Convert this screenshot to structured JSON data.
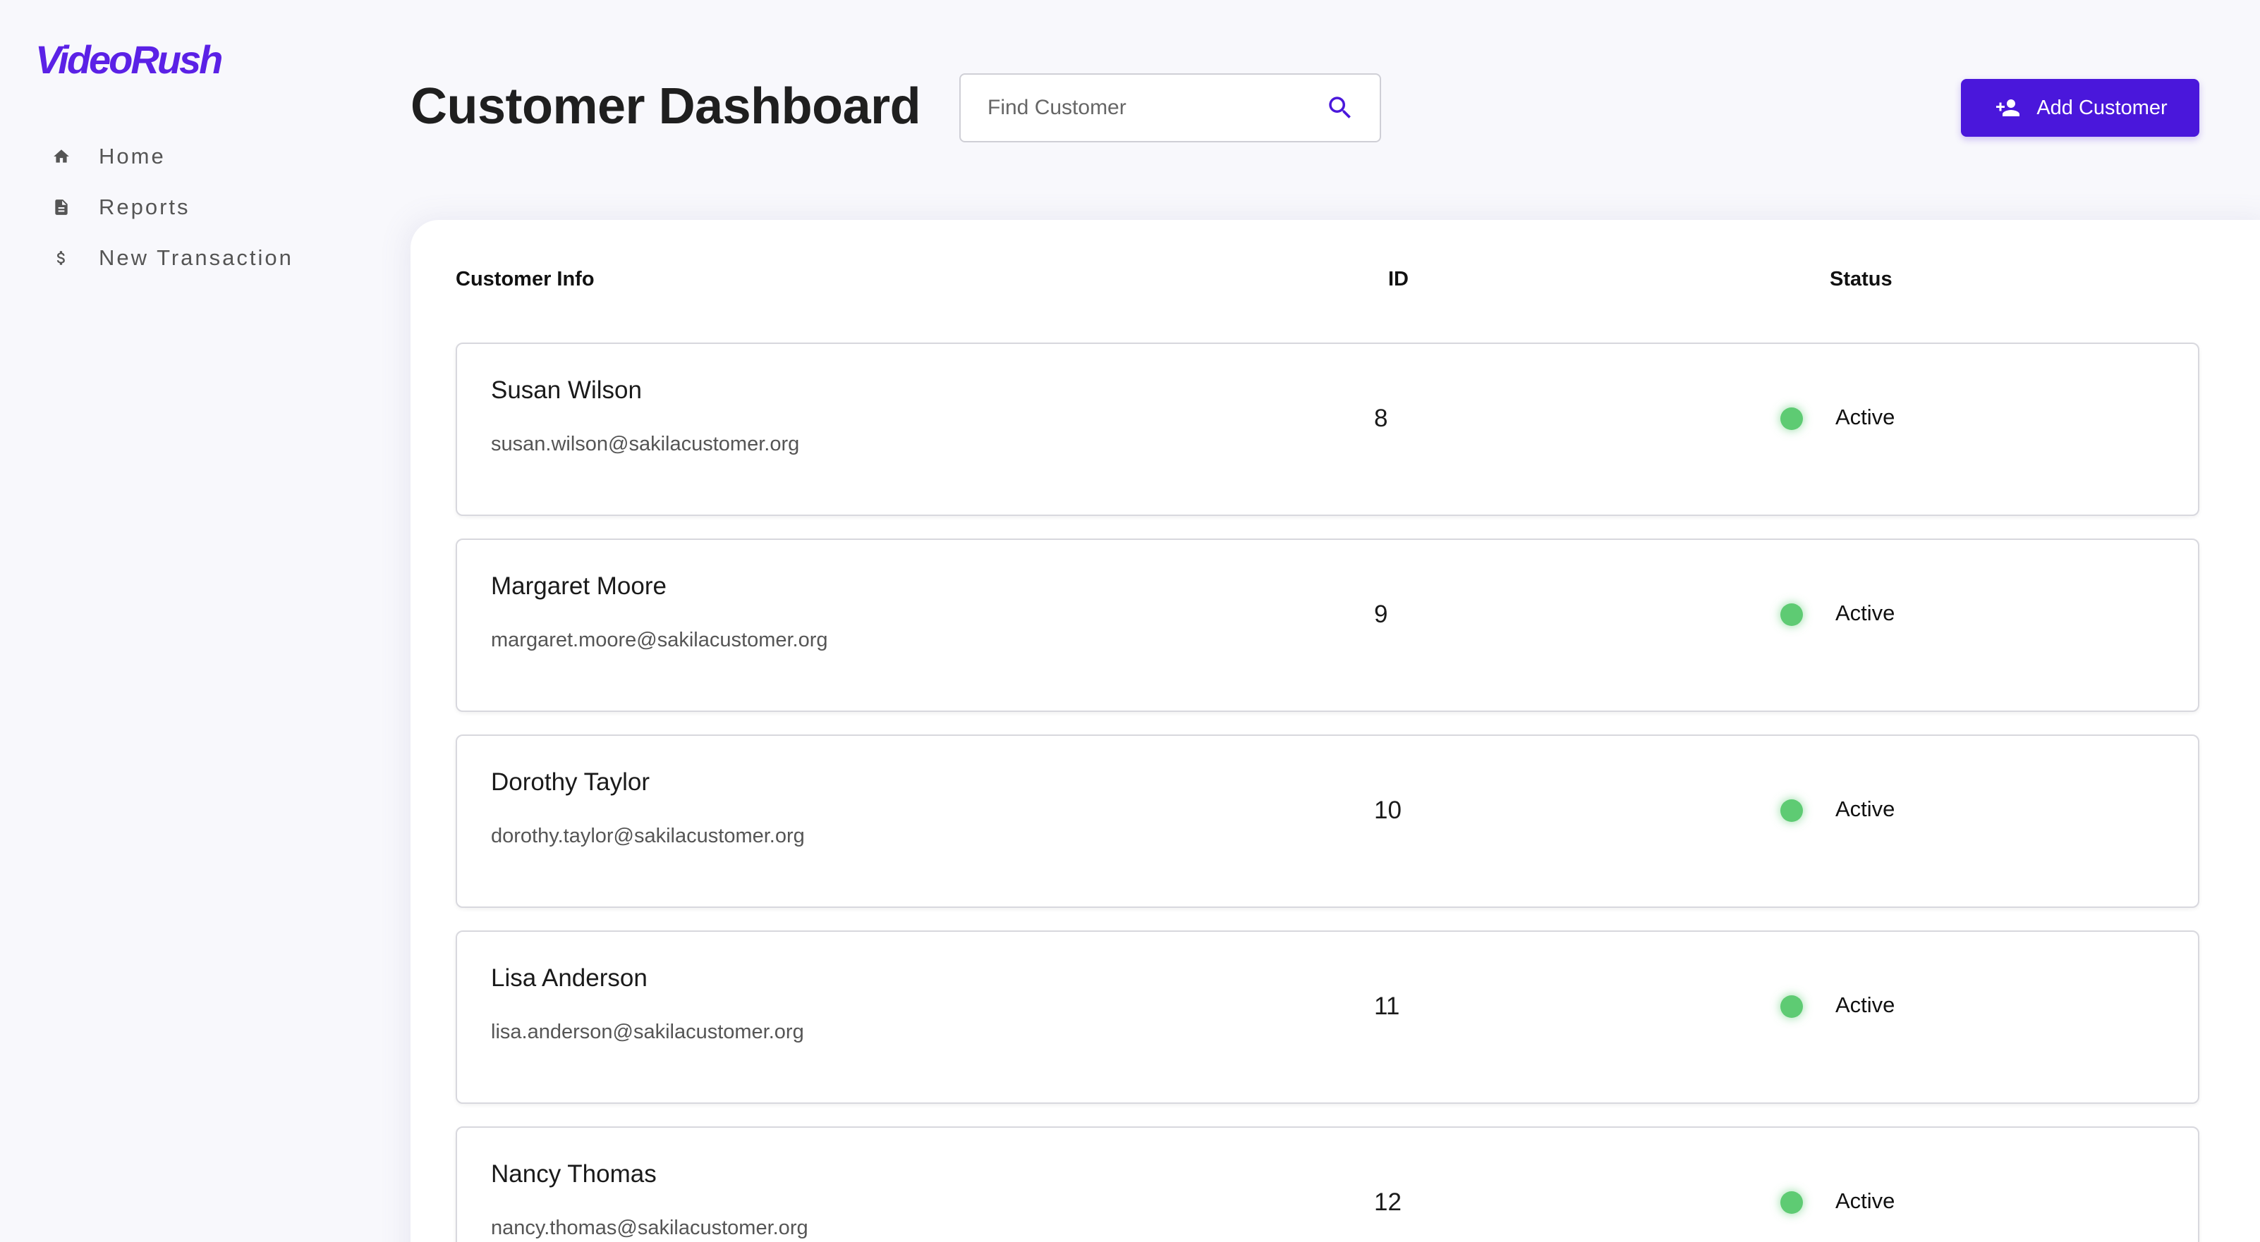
{
  "app": {
    "logo_text_1": "Video",
    "logo_text_2": "Rush",
    "brand_color": "#4a17db"
  },
  "sidebar": {
    "items": [
      {
        "label": "Home",
        "icon": "home-icon"
      },
      {
        "label": "Reports",
        "icon": "document-icon"
      },
      {
        "label": "New Transaction",
        "icon": "dollar-icon"
      }
    ]
  },
  "header": {
    "title": "Customer Dashboard",
    "search_placeholder": "Find Customer",
    "add_button_label": "Add Customer"
  },
  "table": {
    "columns": {
      "info": "Customer Info",
      "id": "ID",
      "status": "Status"
    },
    "rows": [
      {
        "name": "Susan Wilson",
        "email": "susan.wilson@sakilacustomer.org",
        "id": "8",
        "status": "Active",
        "status_color": "#5ecb73"
      },
      {
        "name": "Margaret Moore",
        "email": "margaret.moore@sakilacustomer.org",
        "id": "9",
        "status": "Active",
        "status_color": "#5ecb73"
      },
      {
        "name": "Dorothy Taylor",
        "email": "dorothy.taylor@sakilacustomer.org",
        "id": "10",
        "status": "Active",
        "status_color": "#5ecb73"
      },
      {
        "name": "Lisa Anderson",
        "email": "lisa.anderson@sakilacustomer.org",
        "id": "11",
        "status": "Active",
        "status_color": "#5ecb73"
      },
      {
        "name": "Nancy Thomas",
        "email": "nancy.thomas@sakilacustomer.org",
        "id": "12",
        "status": "Active",
        "status_color": "#5ecb73"
      }
    ]
  }
}
